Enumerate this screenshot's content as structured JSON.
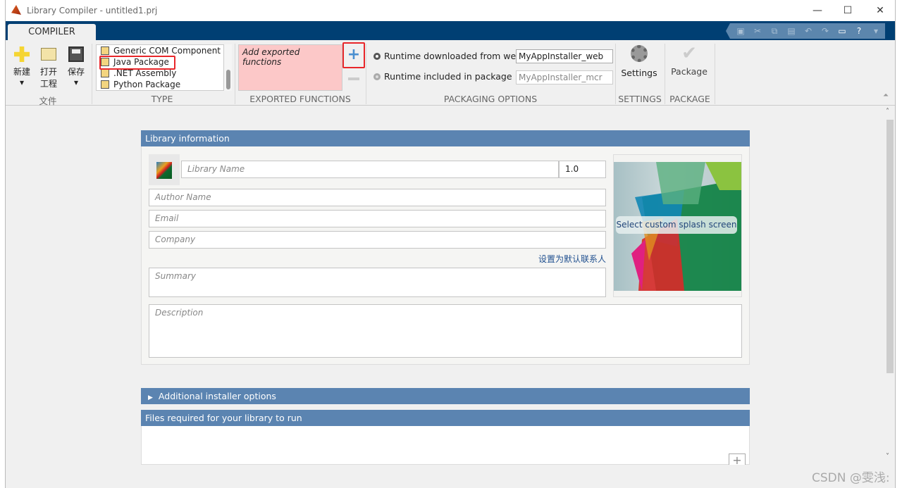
{
  "window": {
    "title": "Library Compiler - untitled1.prj",
    "minimize": "—",
    "maximize": "☐",
    "close": "✕"
  },
  "ribbon": {
    "tab": "COMPILER",
    "quick_access_icons": [
      "save-icon",
      "cut-icon",
      "copy-icon",
      "paste-icon",
      "undo-icon",
      "redo-icon",
      "window-icon",
      "help-icon",
      "dropdown-icon"
    ],
    "file": {
      "new": "新建",
      "open_line1": "打开",
      "open_line2": "工程",
      "save": "保存",
      "section": "文件"
    },
    "type": {
      "items": [
        "Generic COM Component",
        "Java Package",
        ".NET Assembly",
        "Python Package"
      ],
      "selected": "Java Package",
      "section": "TYPE"
    },
    "exported": {
      "placeholder": "Add exported functions",
      "add": "+",
      "remove": "−",
      "section": "EXPORTED FUNCTIONS"
    },
    "packaging": {
      "web_label": "Runtime downloaded from web",
      "web_value": "MyAppInstaller_web",
      "pkg_label": "Runtime included in package",
      "pkg_value": "MyAppInstaller_mcr",
      "selected": "web",
      "section": "PACKAGING OPTIONS"
    },
    "settings": {
      "label": "Settings",
      "section": "SETTINGS"
    },
    "package": {
      "label": "Package",
      "section": "PACKAGE"
    }
  },
  "library_info": {
    "header": "Library information",
    "name_placeholder": "Library Name",
    "version": "1.0",
    "author_placeholder": "Author Name",
    "email_placeholder": "Email",
    "company_placeholder": "Company",
    "set_default_link": "设置为默认联系人",
    "summary_placeholder": "Summary",
    "description_placeholder": "Description",
    "splash_button": "Select custom splash screen"
  },
  "additional": {
    "header": "Additional installer options",
    "expand_icon": "▶"
  },
  "files": {
    "header": "Files required for your library to run",
    "add": "+"
  },
  "watermark": "CSDN @雯浅:",
  "colors": {
    "ribbon_bar": "#003f73",
    "panel_header": "#5b84b1",
    "exported_bg": "#fcc8c8",
    "highlight": "#e8262a"
  }
}
